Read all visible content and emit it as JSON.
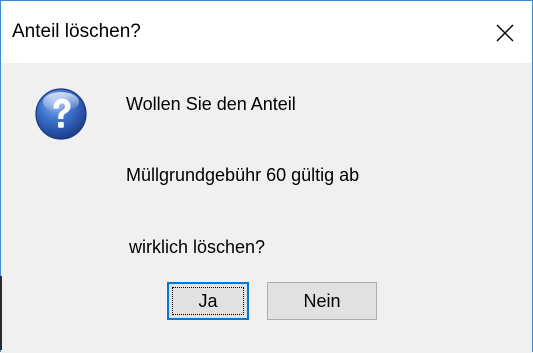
{
  "dialog": {
    "title": "Anteil löschen?",
    "close_glyph": "✕",
    "icon": "question-icon",
    "message_line1": "Wollen Sie den Anteil",
    "message_line2": "Müllgrundgebühr 60 gültig ab",
    "message_line3": "wirklich löschen?",
    "yes_label": "Ja",
    "no_label": "Nein"
  },
  "colors": {
    "title_bg": "#ffffff",
    "body_bg": "#f0f0f0",
    "accent_border": "#0078d7",
    "button_bg": "#e1e1e1",
    "icon_blue": "#2a5fb8"
  }
}
